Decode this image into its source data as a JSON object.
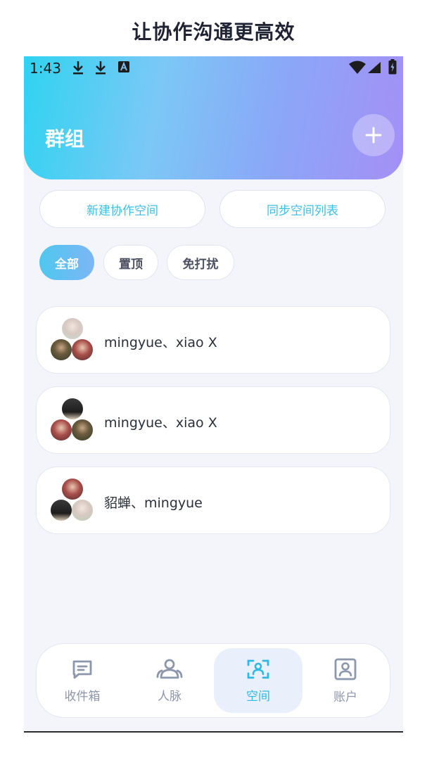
{
  "promo": {
    "title": "让协作沟通更高效"
  },
  "status_bar": {
    "time": "1:43"
  },
  "header": {
    "title": "群组"
  },
  "actions": {
    "new_space": "新建协作空间",
    "sync_spaces": "同步空间列表"
  },
  "filters": [
    {
      "label": "全部",
      "active": true
    },
    {
      "label": "置顶",
      "active": false
    },
    {
      "label": "免打扰",
      "active": false
    }
  ],
  "groups": [
    {
      "name": "mingyue、xiao X"
    },
    {
      "name": "mingyue、xiao X"
    },
    {
      "name": "貂蝉、mingyue"
    }
  ],
  "bottom_nav": [
    {
      "label": "收件箱",
      "icon": "message-icon",
      "active": false
    },
    {
      "label": "人脉",
      "icon": "people-icon",
      "active": false
    },
    {
      "label": "空间",
      "icon": "space-scan-icon",
      "active": true
    },
    {
      "label": "账户",
      "icon": "account-icon",
      "active": false
    }
  ],
  "colors": {
    "accent": "#2fb8e0",
    "gradient_start": "#2fd3f1",
    "gradient_end": "#a48ff6"
  }
}
